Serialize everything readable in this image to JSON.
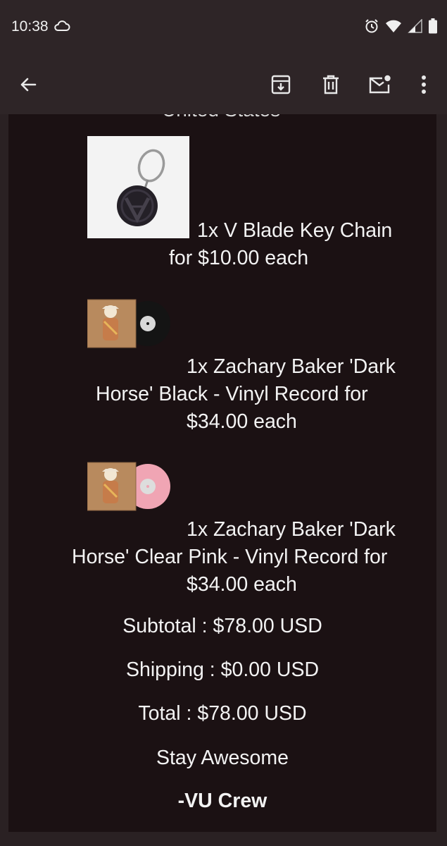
{
  "status_bar": {
    "time": "10:38"
  },
  "app_bar": {
    "back_icon": "arrow-left-icon",
    "actions": [
      "archive-icon",
      "delete-icon",
      "mark-unread-icon",
      "more-vert-icon"
    ]
  },
  "email": {
    "cut_line": "United States",
    "items": [
      {
        "line1": "1x V Blade Key Chain",
        "line2": "for $10.00 each"
      },
      {
        "line1": "1x Zachary Baker 'Dark",
        "line2": "Horse' Black - Vinyl Record for",
        "line3": "$34.00 each"
      },
      {
        "line1": "1x Zachary Baker 'Dark",
        "line2": "Horse' Clear Pink - Vinyl Record for",
        "line3": "$34.00 each"
      }
    ],
    "subtotal": "Subtotal : $78.00 USD",
    "shipping": "Shipping : $0.00 USD",
    "total": "Total : $78.00 USD",
    "closing": "Stay Awesome",
    "signoff": "-VU Crew"
  },
  "colors": {
    "app_bar_bg": "#2e2527",
    "email_bg": "#1b1113",
    "text": "#f3f3f3",
    "pink_vinyl": "#f0a5b4"
  }
}
